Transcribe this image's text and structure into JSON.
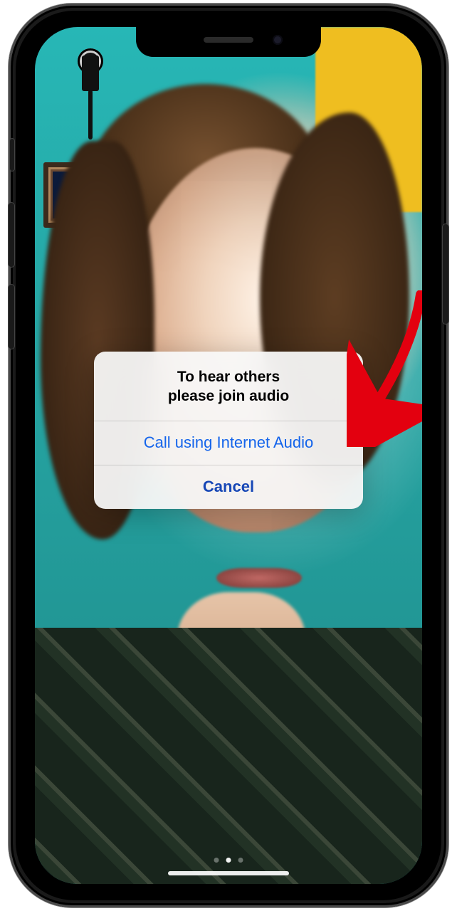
{
  "dialog": {
    "message_line1": "To hear others",
    "message_line2": "please join audio",
    "primary_label": "Call using Internet Audio",
    "cancel_label": "Cancel"
  },
  "annotation": {
    "arrow_color": "#e3000f"
  }
}
